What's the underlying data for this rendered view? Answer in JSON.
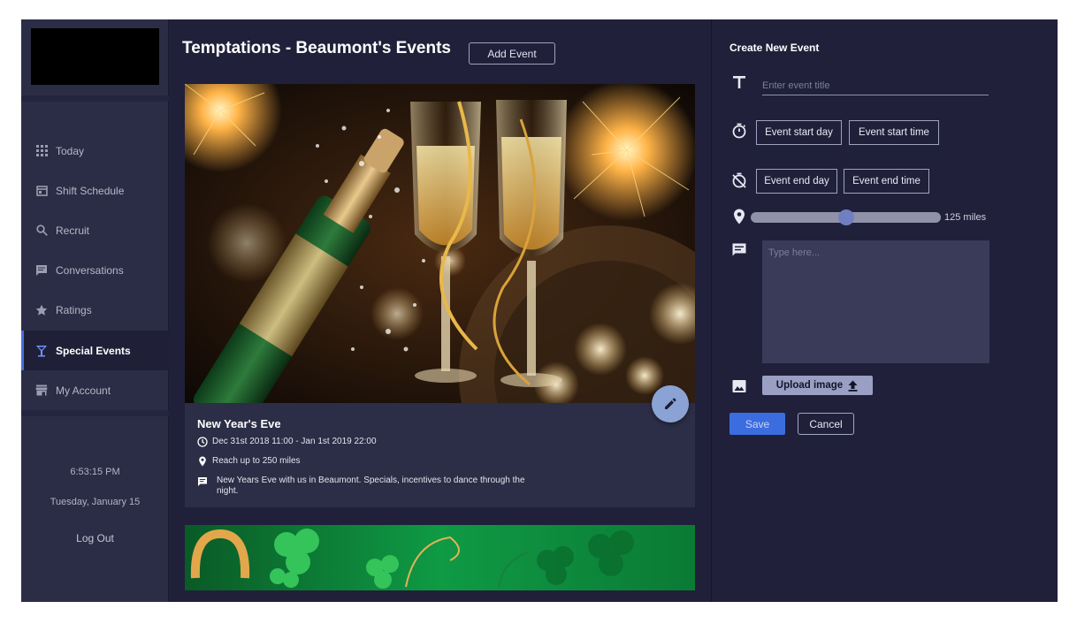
{
  "sidebar": {
    "items": [
      {
        "label": "Today",
        "icon": "grid-icon"
      },
      {
        "label": "Shift Schedule",
        "icon": "calendar-icon"
      },
      {
        "label": "Recruit",
        "icon": "search-icon"
      },
      {
        "label": "Conversations",
        "icon": "chat-icon"
      },
      {
        "label": "Ratings",
        "icon": "star-icon"
      },
      {
        "label": "Special Events",
        "icon": "cocktail-icon",
        "active": true
      },
      {
        "label": "My Account",
        "icon": "store-icon"
      }
    ],
    "time": "6:53:15 PM",
    "date": "Tuesday, January 15",
    "logout_label": "Log Out"
  },
  "main": {
    "title": "Temptations - Beaumont's Events",
    "add_event_label": "Add Event",
    "events": [
      {
        "title": "New Year's Eve",
        "datetime": "Dec 31st 2018 11:00 - Jan 1st 2019 22:00",
        "reach": "Reach up to 250 miles",
        "description": "New Years Eve with us in Beaumont. Specials, incentives to dance through the night."
      }
    ]
  },
  "panel": {
    "title": "Create New Event",
    "title_placeholder": "Enter event title",
    "start_day_label": "Event start day",
    "start_time_label": "Event start time",
    "end_day_label": "Event end day",
    "end_time_label": "Event end time",
    "radius_label": "125 miles",
    "radius_fraction": 0.5,
    "description_placeholder": "Type here...",
    "upload_label": "Upload image",
    "save_label": "Save",
    "cancel_label": "Cancel"
  },
  "colors": {
    "app_bg": "#20203a",
    "sidebar_bg": "#2b2c45",
    "accent": "#3b6de0",
    "fab": "#8aa3d4"
  }
}
